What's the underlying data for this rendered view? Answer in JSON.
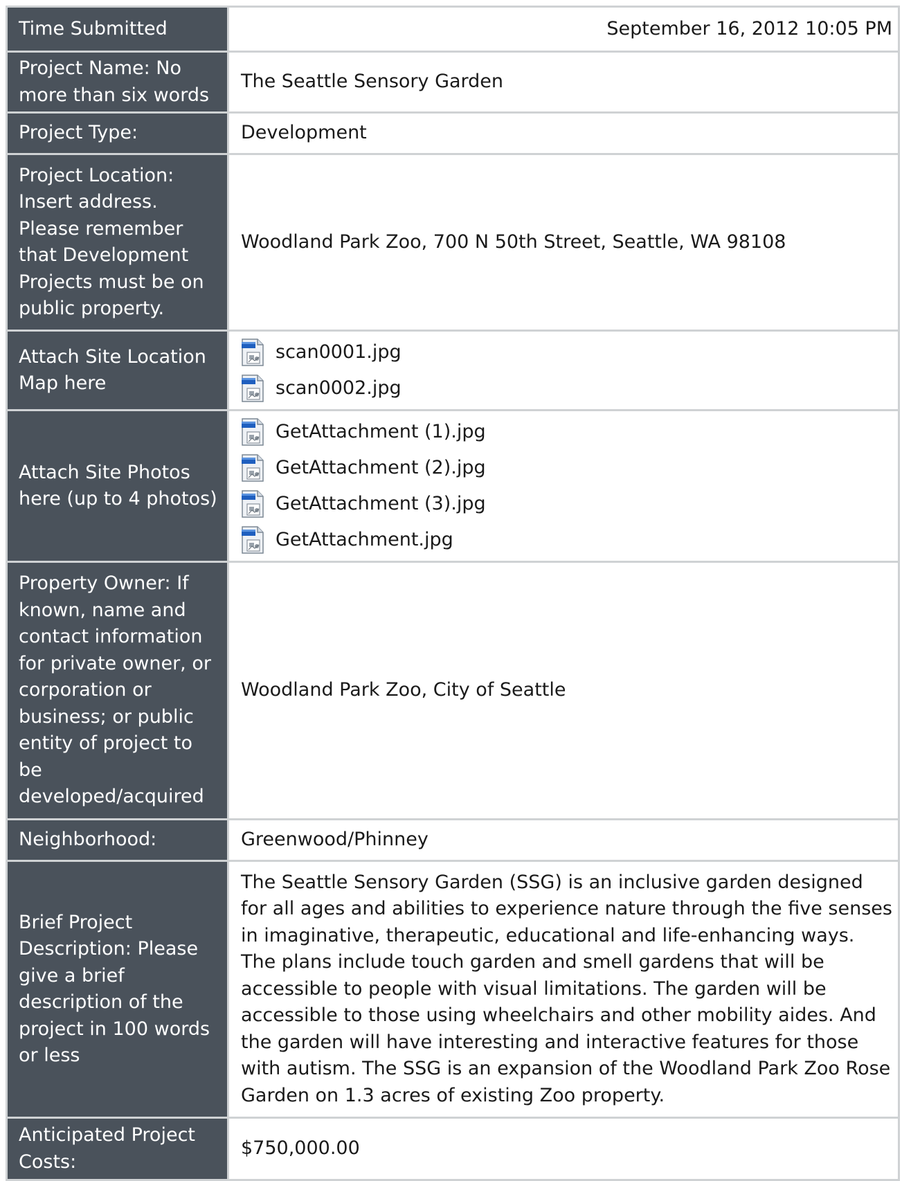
{
  "rows": {
    "time": {
      "label": "Time Submitted",
      "value": "September 16, 2012 10:05 PM"
    },
    "name": {
      "label": "Project Name: No more than six words",
      "value": "The Seattle Sensory Garden"
    },
    "type": {
      "label": "Project Type:",
      "value": "Development"
    },
    "location": {
      "label": "Project Location: Insert address. Please remember that Development Projects must be on public property.",
      "value": "Woodland Park Zoo, 700 N 50th Street, Seattle, WA 98108"
    },
    "map": {
      "label": "Attach Site Location Map here",
      "files": [
        "scan0001.jpg",
        "scan0002.jpg"
      ]
    },
    "photos": {
      "label": "Attach Site Photos here (up to 4 photos)",
      "files": [
        "GetAttachment (1).jpg",
        "GetAttachment (2).jpg",
        "GetAttachment (3).jpg",
        "GetAttachment.jpg"
      ]
    },
    "owner": {
      "label": "Property Owner: If known, name and contact information for private owner, or corporation or business; or public entity of project to be developed/acquired",
      "value": "Woodland Park Zoo, City of Seattle"
    },
    "neighborhood": {
      "label": "Neighborhood:",
      "value": "Greenwood/Phinney"
    },
    "description": {
      "label": "Brief Project Description: Please give a brief description of the project in 100 words or less",
      "value": "The Seattle Sensory Garden (SSG) is an inclusive garden designed for all ages and abilities to experience nature through the five senses in imaginative, therapeutic, educational and life-enhancing ways. The plans include touch garden and smell gardens that will be accessible to people with visual limitations. The garden will be accessible to those using wheelchairs and other mobility aides. And the garden will have interesting and interactive features for those with autism. The SSG is an expansion of the Woodland Park Zoo Rose Garden on 1.3 acres of existing Zoo property."
    },
    "costs": {
      "label": "Anticipated Project Costs:",
      "value": "$750,000.00"
    }
  },
  "icons": {
    "attachment": "image-file-icon"
  }
}
